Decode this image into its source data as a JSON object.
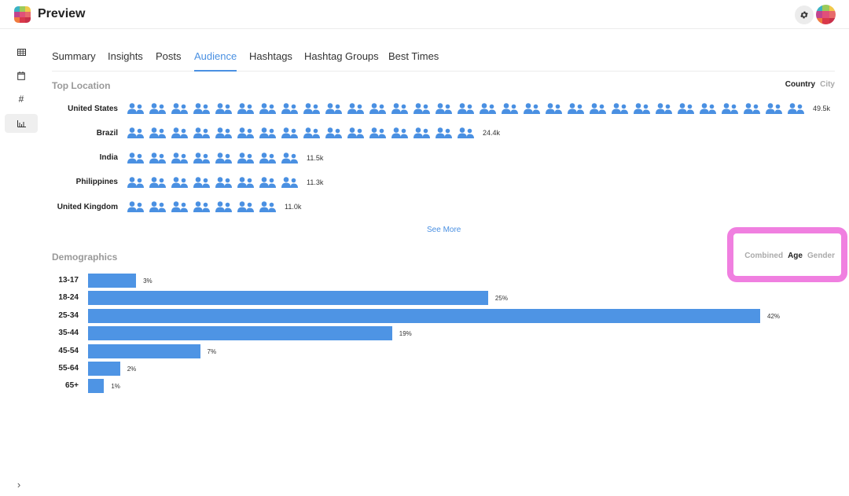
{
  "app": {
    "title": "Preview",
    "logo_colors": [
      "#3bb3c4",
      "#9ccb5a",
      "#f0c94b",
      "#c0448f",
      "#e0507a",
      "#e86b6b",
      "#f07b3f",
      "#d9384a",
      "#c9304a"
    ],
    "avatar_colors": [
      "#3bb3c4",
      "#9ccb5a",
      "#f0c94b",
      "#c0448f",
      "#e0507a",
      "#e86b6b",
      "#f07b3f",
      "#d9384a",
      "#c9304a"
    ]
  },
  "header": {
    "settings_icon": "gear-icon",
    "avatar_icon": "avatar"
  },
  "sidebar": {
    "items": [
      {
        "name": "grid",
        "icon": "grid-icon",
        "active": false
      },
      {
        "name": "calendar",
        "icon": "calendar-icon",
        "active": false
      },
      {
        "name": "hashtag",
        "icon": "hashtag-icon",
        "active": false
      },
      {
        "name": "analytics",
        "icon": "bar-chart-icon",
        "active": true
      }
    ],
    "expand_icon": "chevron-right-icon"
  },
  "tabs": [
    {
      "label": "Summary",
      "active": false
    },
    {
      "label": "Insights",
      "active": false
    },
    {
      "label": "Posts",
      "active": false
    },
    {
      "label": "Audience",
      "active": true
    },
    {
      "label": "Hashtags",
      "active": false
    },
    {
      "label": "Hashtag Groups",
      "active": false
    },
    {
      "label": "Best Times",
      "active": false
    }
  ],
  "top_location": {
    "title": "Top Location",
    "toggles": [
      {
        "label": "Country",
        "active": true
      },
      {
        "label": "City",
        "active": false
      }
    ],
    "rows": [
      {
        "name": "United States",
        "value": "49.5k",
        "icon_count": 31
      },
      {
        "name": "Brazil",
        "value": "24.4k",
        "icon_count": 16
      },
      {
        "name": "India",
        "value": "11.5k",
        "icon_count": 8
      },
      {
        "name": "Philippines",
        "value": "11.3k",
        "icon_count": 8
      },
      {
        "name": "United Kingdom",
        "value": "11.0k",
        "icon_count": 7
      }
    ],
    "see_more": "See More",
    "icon_color": "#4a90e2"
  },
  "demographics": {
    "title": "Demographics",
    "toggles": [
      {
        "label": "Combined",
        "active": false
      },
      {
        "label": "Age",
        "active": true
      },
      {
        "label": "Gender",
        "active": false
      }
    ],
    "bar_color": "#4e94e4",
    "highlight_color": "#f07fe0"
  },
  "chart_data": {
    "type": "bar",
    "orientation": "horizontal",
    "title": "Demographics",
    "categories": [
      "13-17",
      "18-24",
      "25-34",
      "35-44",
      "45-54",
      "55-64",
      "65+"
    ],
    "values": [
      3,
      25,
      42,
      19,
      7,
      2,
      1
    ],
    "value_labels": [
      "3%",
      "25%",
      "42%",
      "19%",
      "7%",
      "2%",
      "1%"
    ],
    "xlabel": "",
    "ylabel": "",
    "unit": "%",
    "grid": false
  }
}
